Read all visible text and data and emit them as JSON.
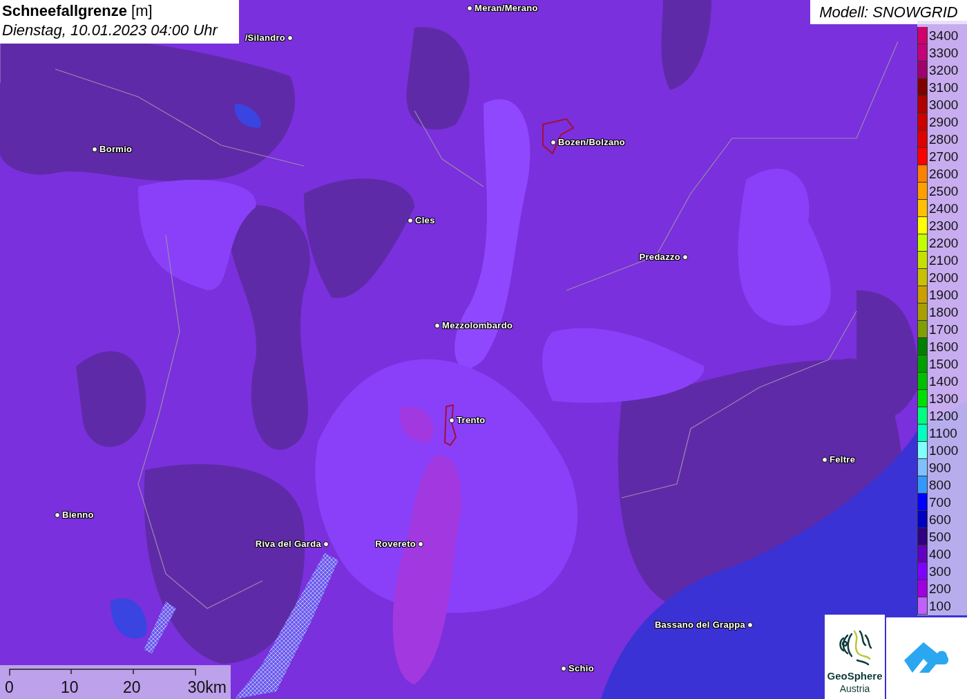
{
  "title": "**Schneefallgrenze** [m]",
  "subtitle": "Dienstag, 10.01.2023 04:00 Uhr",
  "model": "Modell: SNOWGRID",
  "cities": [
    {
      "name": "Meran/Merano"
    },
    {
      "name": "/Silandro"
    },
    {
      "name": "Bormio"
    },
    {
      "name": "Bozen/Bolzano"
    },
    {
      "name": "Cles"
    },
    {
      "name": "Predazzo"
    },
    {
      "name": "Mezzolombardo"
    },
    {
      "name": "Trento"
    },
    {
      "name": "Feltre"
    },
    {
      "name": "Bienno"
    },
    {
      "name": "Riva del Garda"
    },
    {
      "name": "Rovereto"
    },
    {
      "name": "Bassano del Grappa"
    },
    {
      "name": "Schio"
    }
  ],
  "legend": [
    {
      "label": "3400",
      "color": "#d4006a"
    },
    {
      "label": "3300",
      "color": "#c4007a"
    },
    {
      "label": "3200",
      "color": "#a0006e"
    },
    {
      "label": "3100",
      "color": "#800000"
    },
    {
      "label": "3000",
      "color": "#b00000"
    },
    {
      "label": "2900",
      "color": "#cc0000"
    },
    {
      "label": "2800",
      "color": "#e00000"
    },
    {
      "label": "2700",
      "color": "#ff0000"
    },
    {
      "label": "2600",
      "color": "#ff8000"
    },
    {
      "label": "2500",
      "color": "#ffa000"
    },
    {
      "label": "2400",
      "color": "#ffc000"
    },
    {
      "label": "2300",
      "color": "#ffff00"
    },
    {
      "label": "2200",
      "color": "#c0ff00"
    },
    {
      "label": "2100",
      "color": "#c8e000"
    },
    {
      "label": "2000",
      "color": "#c8c000"
    },
    {
      "label": "1900",
      "color": "#c8a000"
    },
    {
      "label": "1800",
      "color": "#a8a000"
    },
    {
      "label": "1700",
      "color": "#80a000"
    },
    {
      "label": "1600",
      "color": "#008000"
    },
    {
      "label": "1500",
      "color": "#00a000"
    },
    {
      "label": "1400",
      "color": "#00c000"
    },
    {
      "label": "1300",
      "color": "#00e000"
    },
    {
      "label": "1200",
      "color": "#00ff80"
    },
    {
      "label": "1100",
      "color": "#00ffc0"
    },
    {
      "label": "1000",
      "color": "#80ffff"
    },
    {
      "label": "900",
      "color": "#80c0ff"
    },
    {
      "label": "800",
      "color": "#3399ff"
    },
    {
      "label": "700",
      "color": "#0000ff"
    },
    {
      "label": "600",
      "color": "#0000c0"
    },
    {
      "label": "500",
      "color": "#300080"
    },
    {
      "label": "400",
      "color": "#6000c0"
    },
    {
      "label": "300",
      "color": "#8000ff"
    },
    {
      "label": "200",
      "color": "#a000e0"
    },
    {
      "label": "100",
      "color": "#c060ff"
    }
  ],
  "scale": {
    "labels": [
      "0",
      "10",
      "20",
      "30km"
    ]
  },
  "logo": {
    "name": "GeoSphere",
    "sub": "Austria"
  }
}
